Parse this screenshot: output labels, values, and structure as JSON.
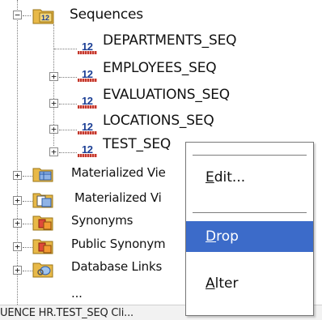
{
  "tree": {
    "sequences_folder": "Sequences",
    "seq_icon_text": "12",
    "sequences": [
      "DEPARTMENTS_SEQ",
      "EMPLOYEES_SEQ",
      "EVALUATIONS_SEQ",
      "LOCATIONS_SEQ",
      "TEST_SEQ"
    ],
    "folders": [
      {
        "label": "Materialized Vie",
        "icon": "materialized-view-icon"
      },
      {
        "label": "Materialized Vi",
        "icon": "materialized-view-log-icon"
      },
      {
        "label": "Synonyms",
        "icon": "synonyms-icon"
      },
      {
        "label": "Public Synonym",
        "icon": "public-synonyms-icon"
      },
      {
        "label": "Database Links",
        "icon": "database-links-icon"
      },
      {
        "label": "...",
        "icon": "folder-icon"
      }
    ]
  },
  "context_menu": {
    "items": [
      {
        "label": "Edit...",
        "mnemonic": "E"
      },
      {
        "label": "Drop",
        "mnemonic": "D"
      },
      {
        "label": "Alter",
        "mnemonic": "A"
      }
    ],
    "highlighted": "Drop",
    "highlight_color": "#3c6bc9"
  },
  "status": {
    "text": "UENCE HR.TEST_SEQ Cli..."
  }
}
